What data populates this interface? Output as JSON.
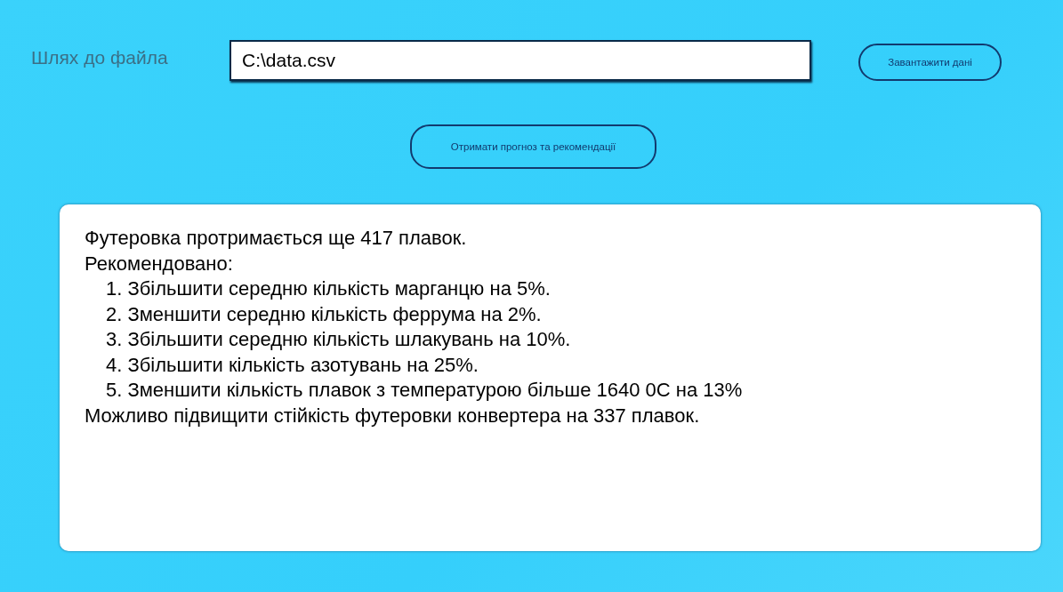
{
  "file_path": {
    "label": "Шлях до файла",
    "value": "C:\\data.csv"
  },
  "load_button": "Завантажити дані",
  "forecast_button": "Отримати прогноз та рекомендації",
  "output": {
    "lines": [
      {
        "kind": "line",
        "text": "Футеровка протримається ще 417 плавок."
      },
      {
        "kind": "line",
        "text": "Рекомендовано:"
      },
      {
        "kind": "item",
        "text": "1. Збільшити середню кількість марганцю на 5%."
      },
      {
        "kind": "item",
        "text": "2. Зменшити середню кількість феррума на 2%."
      },
      {
        "kind": "item",
        "text": "3. Збільшити середню кількість шлакувань на 10%."
      },
      {
        "kind": "item",
        "text": "4. Збільшити кількість азотувань на 25%."
      },
      {
        "kind": "item",
        "text": "5. Зменшити кількість плавок з температурою більше 1640 0C на 13%"
      },
      {
        "kind": "line",
        "text": "Можливо підвищити стійкість футеровки конвертера на 337 плавок."
      }
    ]
  }
}
